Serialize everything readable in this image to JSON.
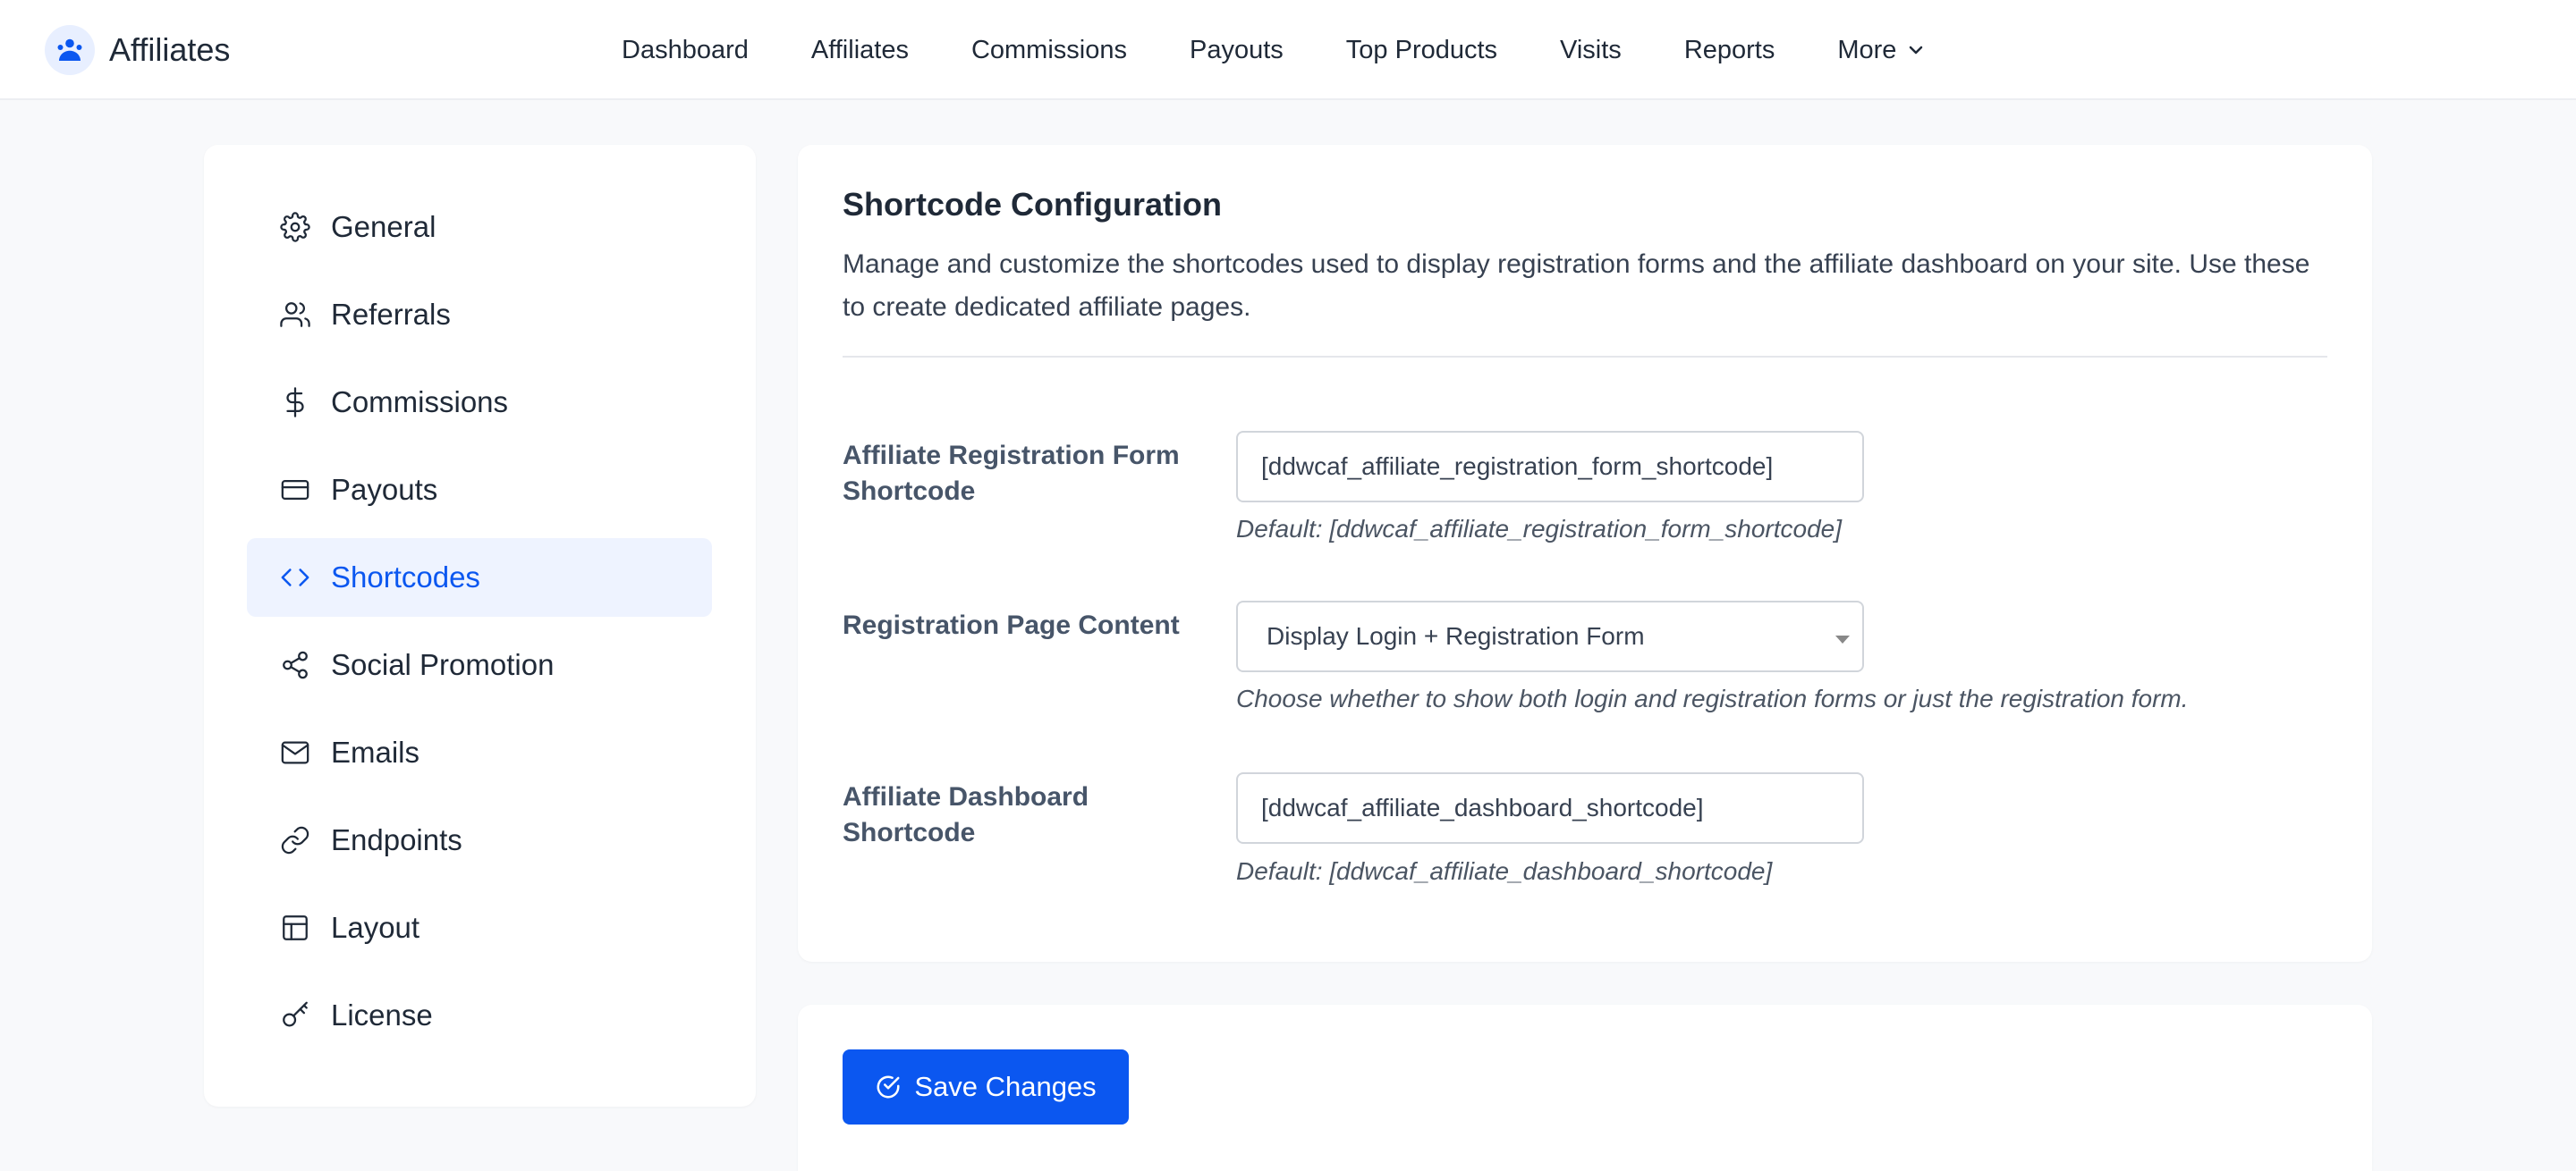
{
  "brand": {
    "name": "Affiliates",
    "accent": "#0b57f0"
  },
  "nav": {
    "items": [
      "Dashboard",
      "Affiliates",
      "Commissions",
      "Payouts",
      "Top Products",
      "Visits",
      "Reports",
      "More"
    ]
  },
  "sidebar": {
    "items": [
      {
        "label": "General",
        "icon": "gear-icon"
      },
      {
        "label": "Referrals",
        "icon": "users-icon"
      },
      {
        "label": "Commissions",
        "icon": "dollar-icon"
      },
      {
        "label": "Payouts",
        "icon": "credit-card-icon"
      },
      {
        "label": "Shortcodes",
        "icon": "code-icon",
        "active": true
      },
      {
        "label": "Social Promotion",
        "icon": "share-icon"
      },
      {
        "label": "Emails",
        "icon": "mail-icon"
      },
      {
        "label": "Endpoints",
        "icon": "link-icon"
      },
      {
        "label": "Layout",
        "icon": "layout-icon"
      },
      {
        "label": "License",
        "icon": "key-icon"
      }
    ]
  },
  "main": {
    "title": "Shortcode Configuration",
    "description": "Manage and customize the shortcodes used to display registration forms and the affiliate dashboard on your site. Use these to create dedicated affiliate pages.",
    "fields": {
      "registration_form": {
        "label": "Affiliate Registration Form Shortcode",
        "value": "[ddwcaf_affiliate_registration_form_shortcode]",
        "help": "Default: [ddwcaf_affiliate_registration_form_shortcode]"
      },
      "registration_page_content": {
        "label": "Registration Page Content",
        "selected": "Display Login + Registration Form",
        "help": "Choose whether to show both login and registration forms or just the registration form."
      },
      "dashboard": {
        "label": "Affiliate Dashboard Shortcode",
        "value": "[ddwcaf_affiliate_dashboard_shortcode]",
        "help": "Default: [ddwcaf_affiliate_dashboard_shortcode]"
      }
    }
  },
  "footer": {
    "save_label": "Save Changes"
  }
}
